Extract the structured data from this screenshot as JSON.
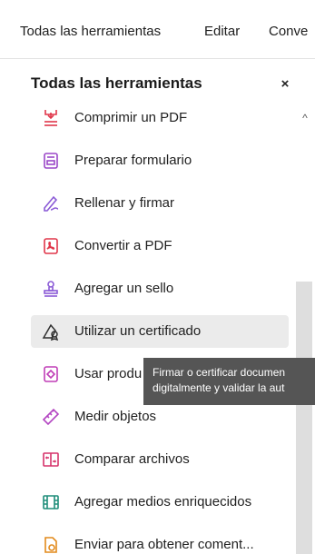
{
  "tabs": [
    "Todas las herramientas",
    "Editar",
    "Conve"
  ],
  "panel": {
    "title": "Todas las herramientas",
    "close_symbol": "×"
  },
  "tools": [
    {
      "label": "Comprimir un PDF",
      "icon": "compress-pdf-icon",
      "color": "#e0364a"
    },
    {
      "label": "Preparar formulario",
      "icon": "prepare-form-icon",
      "color": "#9b47c8"
    },
    {
      "label": "Rellenar y firmar",
      "icon": "fill-sign-icon",
      "color": "#8a5ad6"
    },
    {
      "label": "Convertir a PDF",
      "icon": "convert-pdf-icon",
      "color": "#e0364a"
    },
    {
      "label": "Agregar un sello",
      "icon": "stamp-icon",
      "color": "#8a5ad6"
    },
    {
      "label": "Utilizar un certificado",
      "icon": "certificate-icon",
      "color": "#2f2f2f"
    },
    {
      "label": "Usar produ",
      "icon": "protect-icon",
      "color": "#c03fb7"
    },
    {
      "label": "Medir objetos",
      "icon": "measure-icon",
      "color": "#b345c2"
    },
    {
      "label": "Comparar archivos",
      "icon": "compare-icon",
      "color": "#d6336b"
    },
    {
      "label": "Agregar medios enriquecidos",
      "icon": "rich-media-icon",
      "color": "#1f8d7a"
    },
    {
      "label": "Enviar para obtener coment...",
      "icon": "send-comments-icon",
      "color": "#e28a1c"
    }
  ],
  "tooltip": {
    "line1": "Firmar o certificar documen",
    "line2": "digitalmente y validar la aut"
  },
  "scrollbar": {
    "up_symbol": "^"
  }
}
